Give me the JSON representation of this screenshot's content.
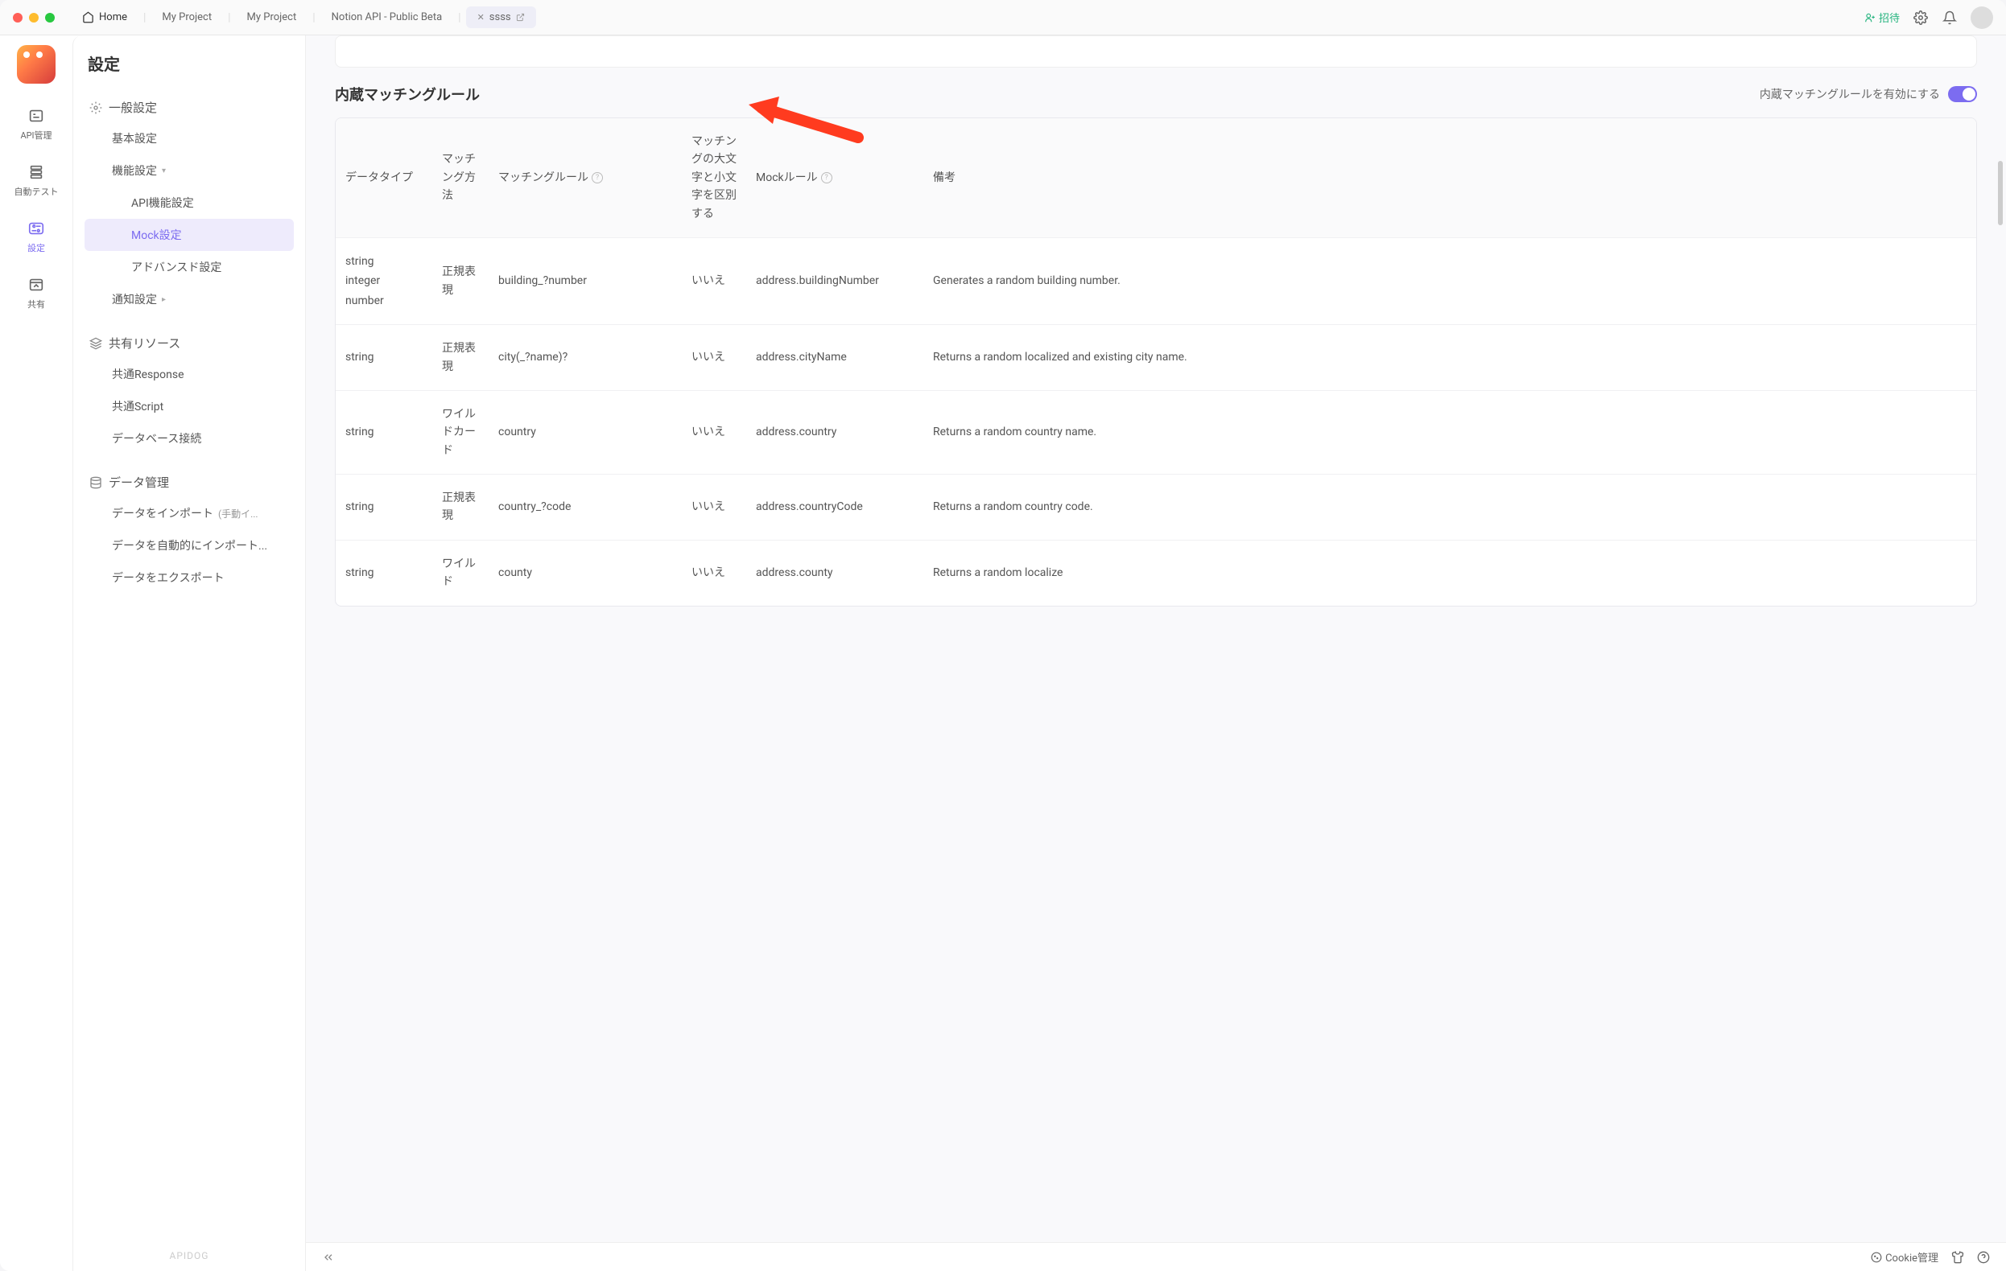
{
  "titlebar": {
    "tabs": [
      {
        "label": "Home",
        "is_home": true
      },
      {
        "label": "My Project"
      },
      {
        "label": "My Project"
      },
      {
        "label": "Notion API - Public Beta"
      },
      {
        "label": "ssss",
        "active": true
      }
    ],
    "invite": "招待"
  },
  "rail": {
    "items": [
      {
        "id": "api",
        "label": "API管理"
      },
      {
        "id": "autotest",
        "label": "自動テスト"
      },
      {
        "id": "settings",
        "label": "設定",
        "active": true
      },
      {
        "id": "share",
        "label": "共有"
      }
    ]
  },
  "sidebar": {
    "title": "設定",
    "footer": "APIDOG",
    "sections": [
      {
        "label": "一般設定",
        "items": [
          {
            "label": "基本設定"
          },
          {
            "label": "機能設定",
            "expandable": true,
            "children": [
              {
                "label": "API機能設定"
              },
              {
                "label": "Mock設定",
                "active": true
              },
              {
                "label": "アドバンスド設定"
              }
            ]
          },
          {
            "label": "通知設定",
            "expandable": true
          }
        ]
      },
      {
        "label": "共有リソース",
        "items": [
          {
            "label": "共通Response"
          },
          {
            "label": "共通Script"
          },
          {
            "label": "データベース接続"
          }
        ]
      },
      {
        "label": "データ管理",
        "items": [
          {
            "label": "データをインポート",
            "suffix": "(手動イ..."
          },
          {
            "label": "データを自動的にインポート..."
          },
          {
            "label": "データをエクスポート"
          }
        ]
      }
    ]
  },
  "main": {
    "section_title": "内蔵マッチングルール",
    "toggle_label": "内蔵マッチングルールを有効にする",
    "table": {
      "headers": {
        "datatype": "データタイプ",
        "match_method": "マッチング方法",
        "match_rule": "マッチングルール",
        "case_sensitive": "マッチングの大文字と小文字を区別する",
        "mock_rule": "Mockルール",
        "remarks": "備考"
      },
      "rows": [
        {
          "datatype": [
            "string",
            "integer",
            "number"
          ],
          "match_method": "正規表現",
          "match_rule": "building_?number",
          "case_sensitive": "いいえ",
          "mock_rule": "address.buildingNumber",
          "remarks": "Generates a random building number."
        },
        {
          "datatype": [
            "string"
          ],
          "match_method": "正規表現",
          "match_rule": "city(_?name)?",
          "case_sensitive": "いいえ",
          "mock_rule": "address.cityName",
          "remarks": "Returns a random localized and existing city name."
        },
        {
          "datatype": [
            "string"
          ],
          "match_method": "ワイルドカード",
          "match_rule": "country",
          "case_sensitive": "いいえ",
          "mock_rule": "address.country",
          "remarks": "Returns a random country name."
        },
        {
          "datatype": [
            "string"
          ],
          "match_method": "正規表現",
          "match_rule": "country_?code",
          "case_sensitive": "いいえ",
          "mock_rule": "address.countryCode",
          "remarks": "Returns a random country code."
        },
        {
          "datatype": [
            "string"
          ],
          "match_method": "ワイルド",
          "match_rule": "county",
          "case_sensitive": "いいえ",
          "mock_rule": "address.county",
          "remarks": "Returns a random localize"
        }
      ]
    }
  },
  "bottom": {
    "cookie": "Cookie管理"
  }
}
